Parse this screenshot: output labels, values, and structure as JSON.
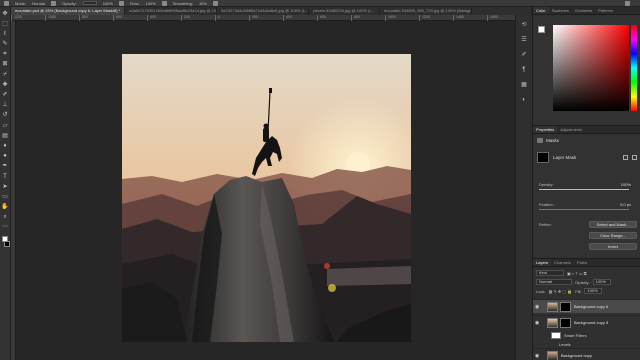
{
  "option_bar": {
    "items": [
      "Mode:",
      "Normal",
      "Opacity:",
      "100%",
      "Flow:",
      "100%",
      "Smoothing:",
      "10%"
    ]
  },
  "tabs": [
    {
      "label": "mountain.psd @ 25% (Background copy 6, Layer Mask/8) *",
      "active": true
    },
    {
      "label": "a2a0c74753512b0b6b8995acf8e23a7d.jpg @ 100% (L...",
      "active": false
    },
    {
      "label": "5e74273a3c3fb85a74d3c8a5e6.jpg @ 100% (L...",
      "active": false
    },
    {
      "label": "pexels-93460234.jpg @ 100% (L...",
      "active": false
    },
    {
      "label": "mountain-934695_960_720.jpg @ 100% (Background...",
      "active": false
    }
  ],
  "ruler_labels": [
    "1200",
    "1000",
    "800",
    "600",
    "400",
    "200",
    "0",
    "200",
    "400",
    "600",
    "800",
    "1000",
    "1200",
    "1400",
    "1600"
  ],
  "color_panel": {
    "tabs": [
      "Color",
      "Swatches",
      "Gradients",
      "Patterns"
    ],
    "foreground": "#ffffff",
    "background": "#000000"
  },
  "properties": {
    "tabs": [
      "Properties",
      "Adjustments"
    ],
    "section": "Masks",
    "mask_label": "Layer Mask",
    "density_label": "Density:",
    "density_value": "100%",
    "density_level": 1.0,
    "feather_label": "Feather:",
    "feather_value": "0.0 px",
    "feather_level": 0.0,
    "refine_label": "Refine:",
    "select_mask_button": "Select and Mask...",
    "color_range_button": "Color Range...",
    "invert_button": "Invert"
  },
  "layers": {
    "tabs": [
      "Layers",
      "Channels",
      "Paths"
    ],
    "filter_kind": "Kind",
    "blend_mode": "Normal",
    "opacity_label": "Opacity:",
    "opacity_value": "100%",
    "lock_label": "Lock:",
    "fill_label": "Fill:",
    "fill_value": "100%",
    "items": [
      {
        "name": "Background copy 6",
        "selected": true
      },
      {
        "name": "Background copy 5",
        "selected": false
      }
    ],
    "sub_items": [
      "Smart Filters",
      "Levels"
    ],
    "bottom_layer": "Background copy"
  },
  "tools": [
    "move-icon",
    "marquee-icon",
    "lasso-icon",
    "quick-select-icon",
    "crop-icon",
    "frame-icon",
    "eyedropper-icon",
    "healing-icon",
    "brush-icon",
    "stamp-icon",
    "history-brush-icon",
    "eraser-icon",
    "gradient-icon",
    "blur-icon",
    "dodge-icon",
    "pen-icon",
    "type-icon",
    "path-select-icon",
    "shape-icon",
    "hand-icon",
    "zoom-icon",
    "more-icon"
  ]
}
